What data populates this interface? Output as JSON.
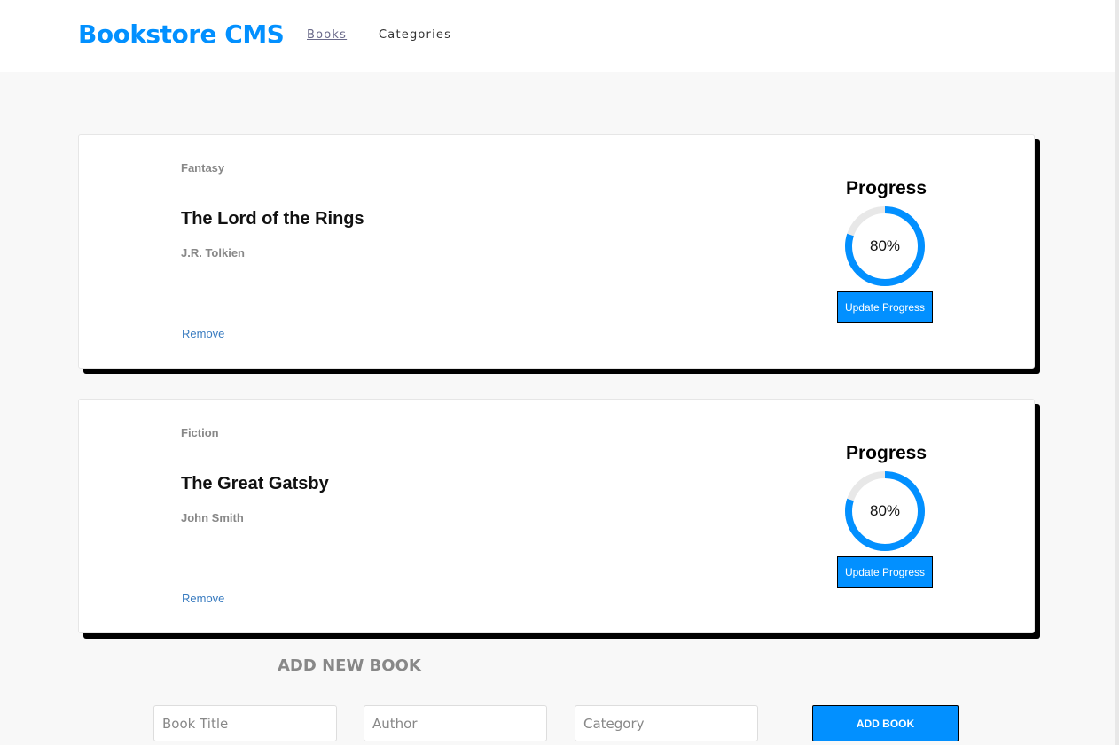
{
  "header": {
    "logo": "Bookstore CMS",
    "nav": [
      {
        "label": "Books"
      },
      {
        "label": "Categories"
      }
    ]
  },
  "books": [
    {
      "category": "Fantasy",
      "title": "The Lord of the Rings",
      "author": "J.R. Tolkien",
      "remove": "Remove",
      "progress_label": "Progress",
      "percent_text": "80%",
      "percent": 80,
      "update": "Update Progress"
    },
    {
      "category": "Fiction",
      "title": "The Great Gatsby",
      "author": "John Smith",
      "remove": "Remove",
      "progress_label": "Progress",
      "percent_text": "80%",
      "percent": 80,
      "update": "Update Progress"
    }
  ],
  "form": {
    "heading": "ADD NEW BOOK",
    "title_placeholder": "Book Title",
    "author_placeholder": "Author",
    "category_placeholder": "Category",
    "submit": "ADD BOOK"
  },
  "colors": {
    "accent": "#0290ff",
    "track": "#e8e8e8"
  }
}
